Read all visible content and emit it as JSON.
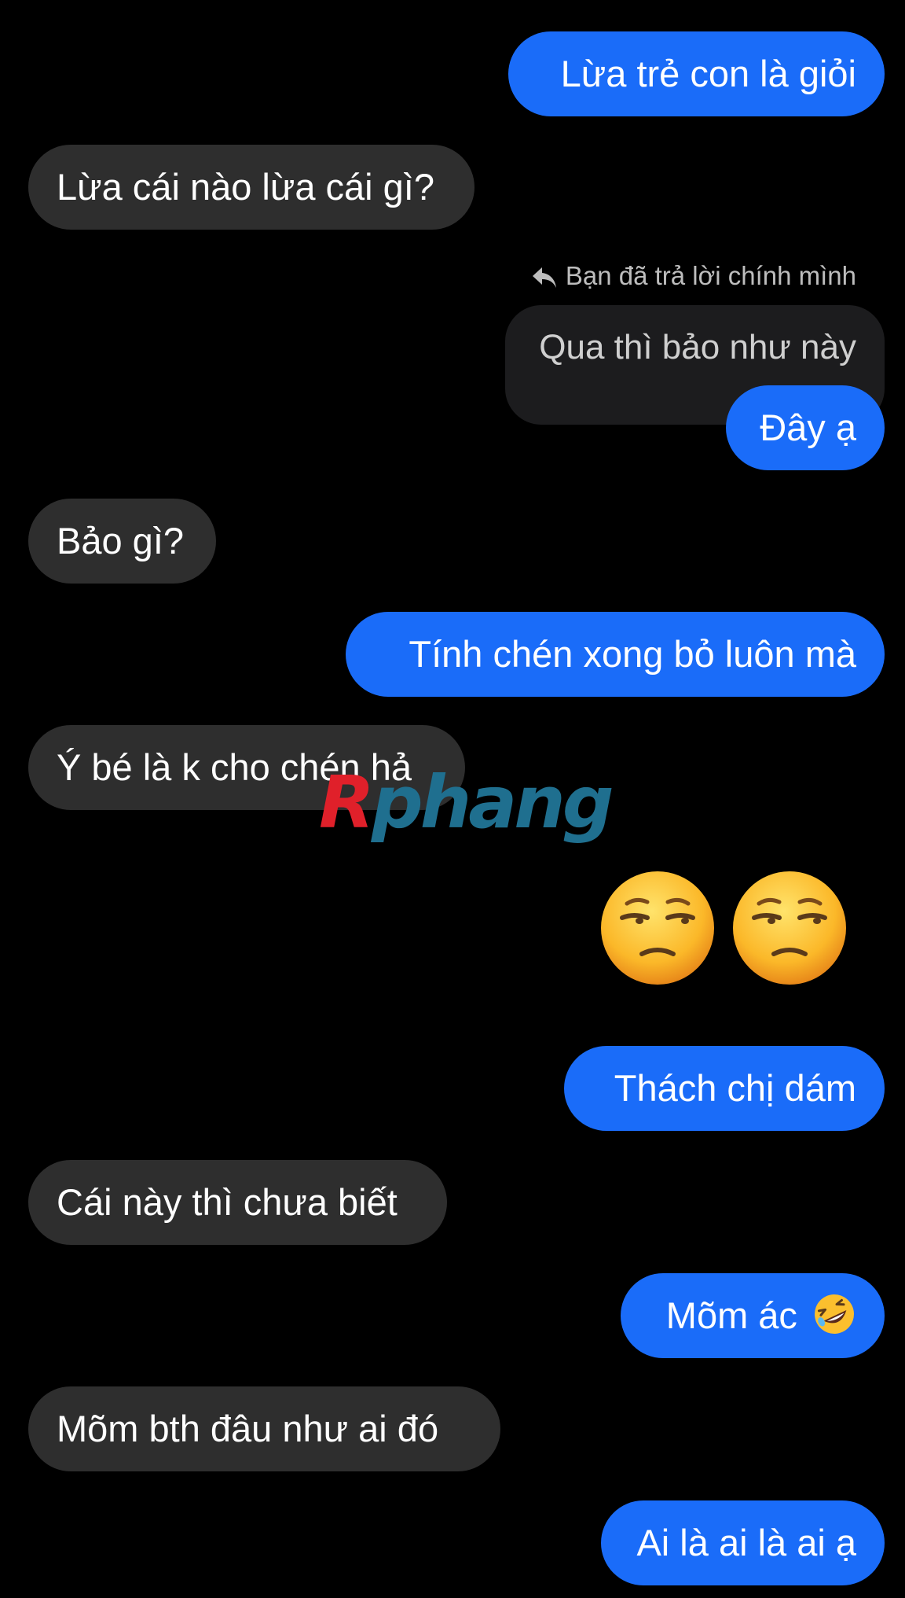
{
  "messages": {
    "m1": "Lừa trẻ con là giỏi",
    "m2": "Lừa cái nào lừa cái gì?",
    "reply_label": "Bạn đã trả lời chính mình",
    "quoted_text": "Qua thì bảo như này",
    "m3": "Đây ạ",
    "m4": "Bảo gì?",
    "m5": "Tính chén xong bỏ luôn mà",
    "m6": "Ý bé là k cho chén hả",
    "m7": "Thách chị dám",
    "m8": "Cái này thì chưa biết",
    "m9_text": "Mõm ác",
    "m10": "Mõm bth đâu như ai đó",
    "m11": "Ai là ai là ai ạ"
  },
  "emojis": {
    "m9_icon": "rolling-on-floor-laughing-emoji",
    "big": [
      "unamused-face-emoji",
      "unamused-face-emoji"
    ]
  },
  "watermark": {
    "first": "R",
    "rest": "phang"
  },
  "colors": {
    "background": "#000000",
    "sent_bubble": "#1a6cf9",
    "received_bubble": "#2e2e2e",
    "quoted_bubble": "#1c1c1e",
    "reply_label": "#bdbdbd",
    "watermark_red": "#e0202a",
    "watermark_teal": "#1f6f8f"
  }
}
